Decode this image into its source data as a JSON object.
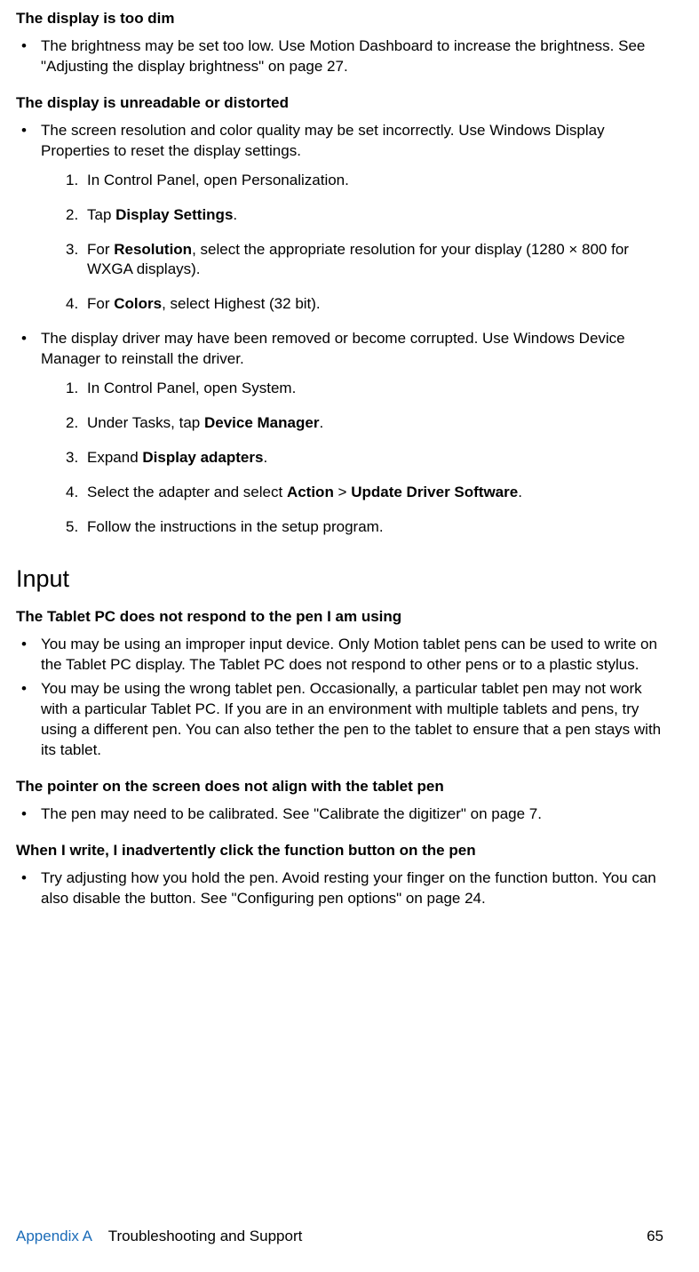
{
  "sec1": {
    "heading": "The display is too dim",
    "b1": "The brightness may be set too low. Use Motion Dashboard to increase the brightness. See \"Adjusting the display brightness\" on page 27."
  },
  "sec2": {
    "heading": "The display is unreadable or distorted",
    "b1": "The screen resolution and color quality may be set incorrectly. Use Windows Display Properties to reset the display settings.",
    "s1": "In Control Panel, open Personalization.",
    "s2a": "Tap ",
    "s2b": "Display Settings",
    "s2c": ".",
    "s3a": "For ",
    "s3b": "Resolution",
    "s3c": ", select the appropriate resolution for your display (1280 × 800 for WXGA displays).",
    "s4a": "For ",
    "s4b": "Colors",
    "s4c": ", select Highest (32 bit).",
    "b2": "The display driver may have been removed or become corrupted. Use Windows Device Manager to reinstall the driver.",
    "t1": "In Control Panel, open System.",
    "t2a": "Under Tasks, tap ",
    "t2b": "Device Manager",
    "t2c": ".",
    "t3a": "Expand ",
    "t3b": "Display adapters",
    "t3c": ".",
    "t4a": "Select the adapter and select ",
    "t4b": "Action",
    "t4c": " > ",
    "t4d": "Update Driver Software",
    "t4e": ".",
    "t5": "Follow the instructions in the setup program."
  },
  "input_heading": "Input",
  "sec3": {
    "heading": "The Tablet PC does not respond to the pen I am using",
    "b1": "You may be using an improper input device. Only Motion tablet pens can be used to write on the Tablet PC display. The Tablet PC does not respond to other pens or to a plastic stylus.",
    "b2": "You may be using the wrong tablet pen. Occasionally, a particular tablet pen may not work with a particular Tablet PC. If you are in an environment with multiple tablets and pens, try using a different pen. You can also tether the pen to the tablet to ensure that a pen stays with its tablet."
  },
  "sec4": {
    "heading": "The pointer on the screen does not align with the tablet pen",
    "b1": "The pen may need to be calibrated. See \"Calibrate the digitizer\" on page 7."
  },
  "sec5": {
    "heading": "When I write, I inadvertently click the function button on the pen",
    "b1": "Try adjusting how you hold the pen. Avoid resting your finger on the function button. You can also disable the button. See \"Configuring pen options\" on page 24."
  },
  "footer": {
    "appendix": "Appendix A",
    "title": "Troubleshooting and Support",
    "page": "65"
  }
}
